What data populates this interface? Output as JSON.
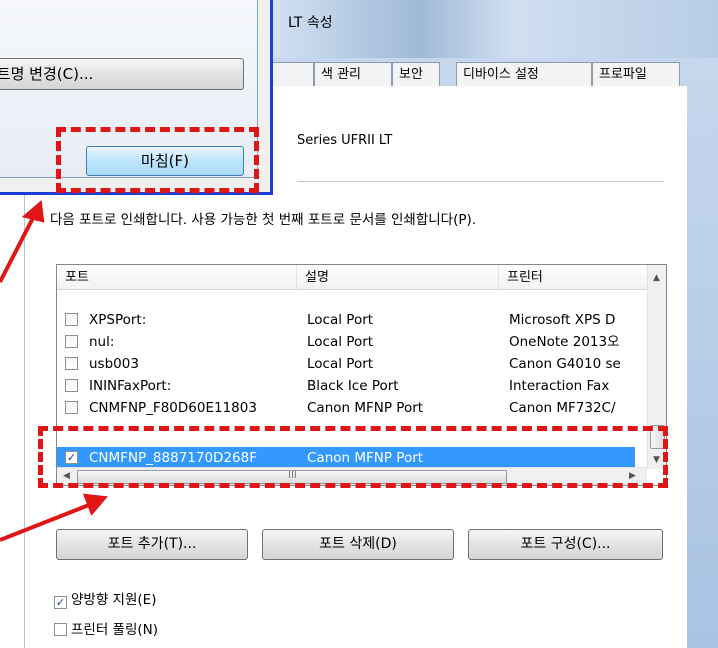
{
  "window": {
    "title": "LT 속성",
    "tabs": [
      {
        "label": ""
      },
      {
        "label": "색 관리"
      },
      {
        "label": "보안"
      },
      {
        "label": "디바이스 설정"
      },
      {
        "label": "프로파일"
      }
    ],
    "driver_name": "Series UFRII LT",
    "instruction": "다음 포트로 인쇄합니다. 사용 가능한 첫 번째 포트로 문서를 인쇄합니다(P)."
  },
  "port_list": {
    "columns": [
      "포트",
      "설명",
      "프린터"
    ],
    "rows": [
      {
        "port": "XPSPort:",
        "description": "Local Port",
        "printer": "Microsoft XPS D",
        "checked": false,
        "selected": false
      },
      {
        "port": "nul:",
        "description": "Local Port",
        "printer": "OneNote 2013오",
        "checked": false,
        "selected": false
      },
      {
        "port": "usb003",
        "description": "Local Port",
        "printer": "Canon G4010 se",
        "checked": false,
        "selected": false
      },
      {
        "port": "ININFaxPort:",
        "description": "Black Ice Port",
        "printer": "Interaction Fax",
        "checked": false,
        "selected": false
      },
      {
        "port": "CNMFNP_F80D60E11803",
        "description": "Canon MFNP Port",
        "printer": "Canon MF732C/",
        "checked": false,
        "selected": false
      },
      {
        "port": "CNMFNP_8887170D268F",
        "description": "Canon MFNP Port",
        "printer": "",
        "checked": true,
        "selected": true
      }
    ],
    "hscroll_glyph": "III"
  },
  "buttons": {
    "add_port": "포트 추가(T)...",
    "delete_port": "포트 삭제(D)",
    "configure_port": "포트 구성(C)..."
  },
  "options": {
    "bidirectional": {
      "label": "양방향 지원(E)",
      "checked": true
    },
    "pooling": {
      "label": "프린터 풀링(N)",
      "checked": false
    }
  },
  "dialog": {
    "rename_button": "포트명 변경(C)...",
    "finish_button": "마침(F)"
  },
  "annotations": {
    "color": "#e01515",
    "frame_color": "#1a3fd8",
    "selection_color": "#3399ff"
  }
}
